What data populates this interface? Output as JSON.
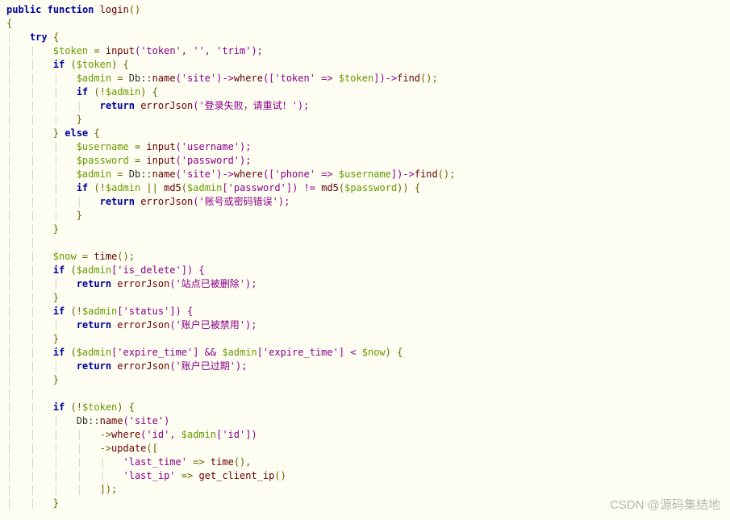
{
  "code": {
    "l1": {
      "kw1": "public",
      "kw2": "function",
      "name": "login",
      "p": "()"
    },
    "l2": {
      "b": "{"
    },
    "l3": {
      "kw": "try",
      "b": " {"
    },
    "l4": {
      "v": "$token",
      "eq": " = ",
      "f": "input",
      "args": "('token', '', 'trim');"
    },
    "l5": {
      "kw": "if",
      "p1": " (",
      "v": "$token",
      "p2": ") {"
    },
    "l6": {
      "v1": "$admin",
      "eq": " = ",
      "cls": "Db::",
      "f1": "name",
      "a1": "('site')->",
      "f2": "where",
      "a2": "(['token' => ",
      "v2": "$token",
      "a3": "])->",
      "f3": "find",
      "a4": "();"
    },
    "l7": {
      "kw": "if",
      "p1": " (!",
      "v": "$admin",
      "p2": ") {"
    },
    "l8": {
      "kw": "return",
      "sp": " ",
      "f": "errorJson",
      "args": "('登录失败，请重试！');"
    },
    "l9": {
      "b": "}"
    },
    "l10": {
      "b1": "} ",
      "kw": "else",
      "b2": " {"
    },
    "l11": {
      "v": "$username",
      "eq": " = ",
      "f": "input",
      "args": "('username');"
    },
    "l12": {
      "v": "$password",
      "eq": " = ",
      "f": "input",
      "args": "('password');"
    },
    "l13": {
      "v1": "$admin",
      "eq": " = ",
      "cls": "Db::",
      "f1": "name",
      "a1": "('site')->",
      "f2": "where",
      "a2": "(['phone' => ",
      "v2": "$username",
      "a3": "])->",
      "f3": "find",
      "a4": "();"
    },
    "l14": {
      "kw": "if",
      "p1": " (!",
      "v1": "$admin",
      "p2": " || ",
      "f1": "md5",
      "p3": "(",
      "v2": "$admin",
      "p4": "['password']) != ",
      "f2": "md5",
      "p5": "(",
      "v3": "$password",
      "p6": ")) {"
    },
    "l15": {
      "kw": "return",
      "sp": " ",
      "f": "errorJson",
      "args": "('账号或密码错误');"
    },
    "l16": {
      "b": "}"
    },
    "l17": {
      "b": "}"
    },
    "l18": {
      "blank": ""
    },
    "l19": {
      "v": "$now",
      "eq": " = ",
      "f": "time",
      "args": "();"
    },
    "l20": {
      "kw": "if",
      "p1": " (",
      "v": "$admin",
      "p2": "['is_delete']) {"
    },
    "l21": {
      "kw": "return",
      "sp": " ",
      "f": "errorJson",
      "args": "('站点已被删除');"
    },
    "l22": {
      "b": "}"
    },
    "l23": {
      "kw": "if",
      "p1": " (!",
      "v": "$admin",
      "p2": "['status']) {"
    },
    "l24": {
      "kw": "return",
      "sp": " ",
      "f": "errorJson",
      "args": "('账户已被禁用');"
    },
    "l25": {
      "b": "}"
    },
    "l26": {
      "kw": "if",
      "p1": " (",
      "v1": "$admin",
      "p2": "['expire_time'] && ",
      "v2": "$admin",
      "p3": "['expire_time'] < ",
      "v3": "$now",
      "p4": ") {"
    },
    "l27": {
      "kw": "return",
      "sp": " ",
      "f": "errorJson",
      "args": "('账户已过期');"
    },
    "l28": {
      "b": "}"
    },
    "l29": {
      "blank": ""
    },
    "l30": {
      "kw": "if",
      "p1": " (!",
      "v": "$token",
      "p2": ") {"
    },
    "l31": {
      "cls": "Db::",
      "f": "name",
      "args": "('site')"
    },
    "l32": {
      "arrow": "->",
      "f": "where",
      "p1": "('id', ",
      "v": "$admin",
      "p2": "['id'])"
    },
    "l33": {
      "arrow": "->",
      "f": "update",
      "args": "(["
    },
    "l34": {
      "s": "'last_time'",
      "arrow": " => ",
      "f": "time",
      "p": "(),"
    },
    "l35": {
      "s": "'last_ip'",
      "arrow": " => ",
      "f": "get_client_ip",
      "p": "()"
    },
    "l36": {
      "b": "]);"
    },
    "l37": {
      "b": "}"
    }
  },
  "watermark": "CSDN @源码集结地"
}
